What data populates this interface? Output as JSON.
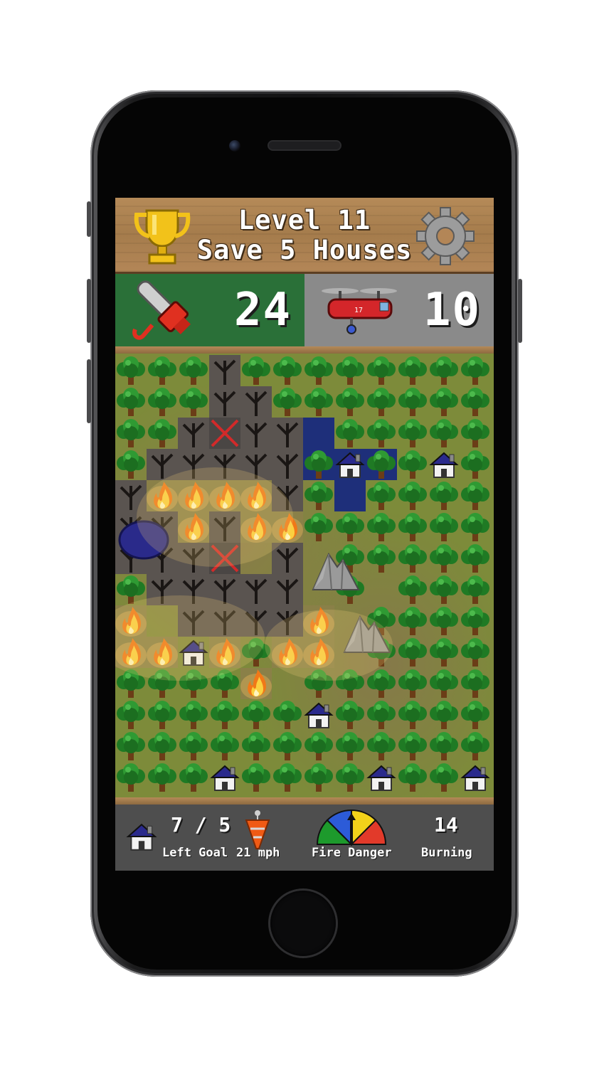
{
  "header": {
    "level_label": "Level 11",
    "goal_label": "Save 5 Houses",
    "trophy_icon": "trophy-icon",
    "settings_icon": "gear-icon"
  },
  "resources": {
    "chainsaw_icon": "chainsaw-icon",
    "chainsaw_count": "24",
    "chainsaw_color": "#2a7038",
    "helicopter_icon": "helicopter-icon",
    "helicopter_count": "10",
    "helicopter_color": "#8a8a8a"
  },
  "status": {
    "houses_value": "7 / 5",
    "houses_label": "Left Goal",
    "wind_speed_label": "21 mph",
    "fire_danger_label": "Fire Danger",
    "burning_value": "14",
    "burning_label": "Burning"
  },
  "map_legend": {
    "tree": "tree-icon",
    "burnt": "burnt-tree-icon",
    "fire": "fire-icon",
    "house": "house-icon",
    "rock": "rock-icon",
    "water": "water-icon"
  }
}
